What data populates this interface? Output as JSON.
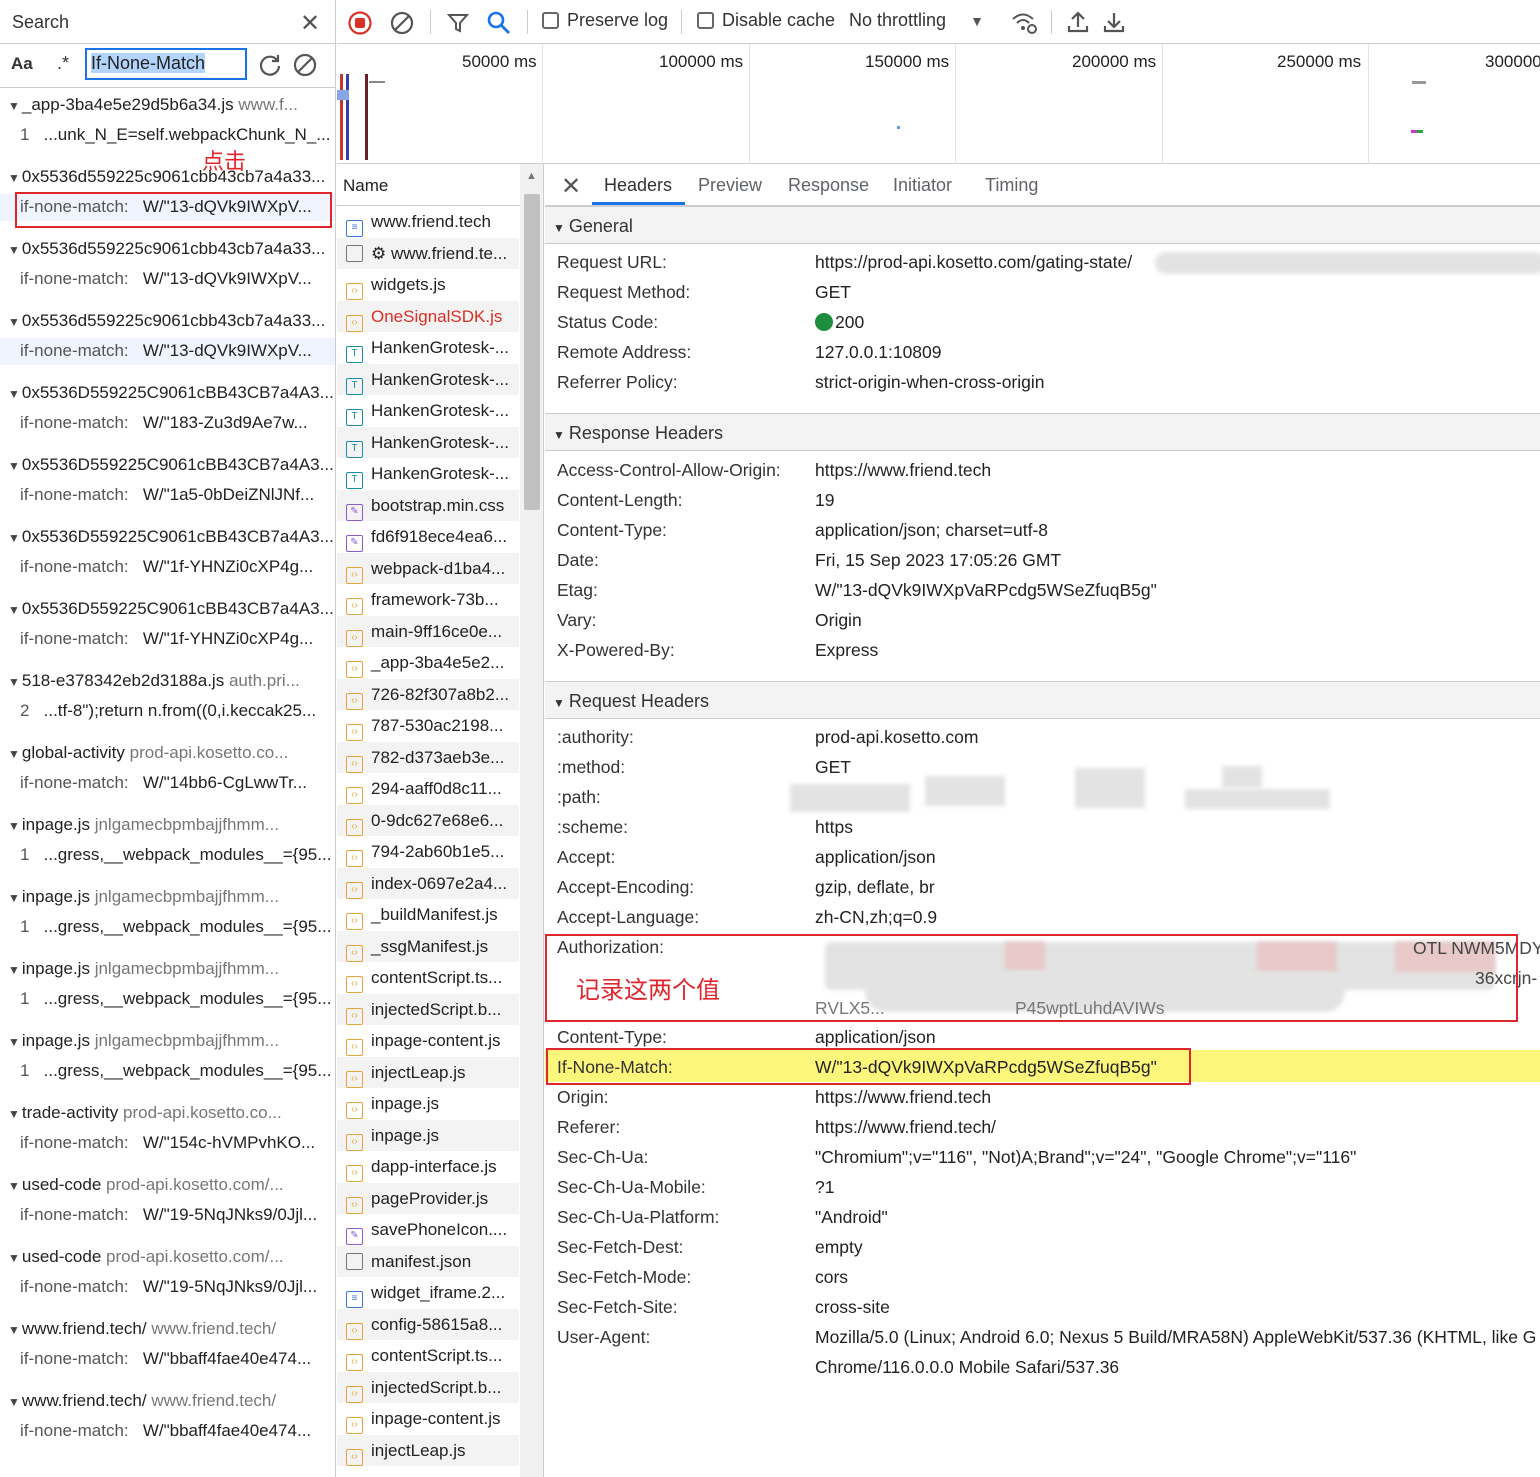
{
  "search": {
    "title": "Search",
    "case_label": "Aa",
    "regex_label": ".*",
    "query": "If-None-Match",
    "annotation": "点击",
    "results": [
      {
        "file": "_app-3ba4e5e29d5b6a34.js",
        "path": "www.f...",
        "line_num": "1",
        "line": "...unk_N_E=self.webpackChunk_N_..."
      },
      {
        "file": "0x5536d559225c9061cbb43cb7a4a33...",
        "path": "",
        "line_num": "if-none-match:",
        "line": "W/\"13-dQVk9IWXpV..."
      },
      {
        "file": "0x5536d559225c9061cbb43cb7a4a33...",
        "path": "",
        "line_num": "if-none-match:",
        "line": "W/\"13-dQVk9IWXpV..."
      },
      {
        "file": "0x5536d559225c9061cbb43cb7a4a33...",
        "path": "",
        "line_num": "if-none-match:",
        "line": "W/\"13-dQVk9IWXpV..."
      },
      {
        "file": "0x5536D559225C9061cBB43CB7a4A3...",
        "path": "",
        "line_num": "if-none-match:",
        "line": "W/\"183-Zu3d9Ae7w..."
      },
      {
        "file": "0x5536D559225C9061cBB43CB7a4A3...",
        "path": "",
        "line_num": "if-none-match:",
        "line": "W/\"1a5-0bDeiZNlJNf..."
      },
      {
        "file": "0x5536D559225C9061cBB43CB7a4A3...",
        "path": "",
        "line_num": "if-none-match:",
        "line": "W/\"1f-YHNZi0cXP4g..."
      },
      {
        "file": "0x5536D559225C9061cBB43CB7a4A3...",
        "path": "",
        "line_num": "if-none-match:",
        "line": "W/\"1f-YHNZi0cXP4g..."
      },
      {
        "file": "518-e378342eb2d3188a.js",
        "path": "auth.pri...",
        "line_num": "2",
        "line": "...tf-8\");return n.from((0,i.keccak25..."
      },
      {
        "file": "global-activity",
        "path": "prod-api.kosetto.co...",
        "line_num": "if-none-match:",
        "line": "W/\"14bb6-CgLwwTr..."
      },
      {
        "file": "inpage.js",
        "path": "jnlgamecbpmbajjfhmm...",
        "line_num": "1",
        "line": "...gress,__webpack_modules__={95..."
      },
      {
        "file": "inpage.js",
        "path": "jnlgamecbpmbajjfhmm...",
        "line_num": "1",
        "line": "...gress,__webpack_modules__={95..."
      },
      {
        "file": "inpage.js",
        "path": "jnlgamecbpmbajjfhmm...",
        "line_num": "1",
        "line": "...gress,__webpack_modules__={95..."
      },
      {
        "file": "inpage.js",
        "path": "jnlgamecbpmbajjfhmm...",
        "line_num": "1",
        "line": "...gress,__webpack_modules__={95..."
      },
      {
        "file": "trade-activity",
        "path": "prod-api.kosetto.co...",
        "line_num": "if-none-match:",
        "line": "W/\"154c-hVMPvhKO..."
      },
      {
        "file": "used-code",
        "path": "prod-api.kosetto.com/...",
        "line_num": "if-none-match:",
        "line": "W/\"19-5NqJNks9/0Jjl..."
      },
      {
        "file": "used-code",
        "path": "prod-api.kosetto.com/...",
        "line_num": "if-none-match:",
        "line": "W/\"19-5NqJNks9/0Jjl..."
      },
      {
        "file": "www.friend.tech/",
        "path": "www.friend.tech/",
        "line_num": "if-none-match:",
        "line": "W/\"bbaff4fae40e474..."
      },
      {
        "file": "www.friend.tech/",
        "path": "www.friend.tech/",
        "line_num": "if-none-match:",
        "line": "W/\"bbaff4fae40e474..."
      }
    ]
  },
  "toolbar": {
    "preserve_log": "Preserve log",
    "disable_cache": "Disable cache",
    "throttling": "No throttling"
  },
  "timeline": {
    "ticks": [
      "50000 ms",
      "100000 ms",
      "150000 ms",
      "200000 ms",
      "250000 ms",
      "300000"
    ]
  },
  "requests": {
    "header": "Name",
    "items": [
      {
        "name": "www.friend.tech",
        "type": "doc"
      },
      {
        "name": "⚙ www.friend.te...",
        "type": "other"
      },
      {
        "name": "widgets.js",
        "type": "script"
      },
      {
        "name": "OneSignalSDK.js",
        "type": "script",
        "error": true
      },
      {
        "name": "HankenGrotesk-...",
        "type": "font"
      },
      {
        "name": "HankenGrotesk-...",
        "type": "font"
      },
      {
        "name": "HankenGrotesk-...",
        "type": "font"
      },
      {
        "name": "HankenGrotesk-...",
        "type": "font"
      },
      {
        "name": "HankenGrotesk-...",
        "type": "font"
      },
      {
        "name": "bootstrap.min.css",
        "type": "style"
      },
      {
        "name": "fd6f918ece4ea6...",
        "type": "style"
      },
      {
        "name": "webpack-d1ba4...",
        "type": "script"
      },
      {
        "name": "framework-73b...",
        "type": "script"
      },
      {
        "name": "main-9ff16ce0e...",
        "type": "script"
      },
      {
        "name": "_app-3ba4e5e2...",
        "type": "script"
      },
      {
        "name": "726-82f307a8b2...",
        "type": "script"
      },
      {
        "name": "787-530ac2198...",
        "type": "script"
      },
      {
        "name": "782-d373aeb3e...",
        "type": "script"
      },
      {
        "name": "294-aaff0d8c11...",
        "type": "script"
      },
      {
        "name": "0-9dc627e68e6...",
        "type": "script"
      },
      {
        "name": "794-2ab60b1e5...",
        "type": "script"
      },
      {
        "name": "index-0697e2a4...",
        "type": "script"
      },
      {
        "name": "_buildManifest.js",
        "type": "script"
      },
      {
        "name": "_ssgManifest.js",
        "type": "script"
      },
      {
        "name": "contentScript.ts...",
        "type": "script"
      },
      {
        "name": "injectedScript.b...",
        "type": "script"
      },
      {
        "name": "inpage-content.js",
        "type": "script"
      },
      {
        "name": "injectLeap.js",
        "type": "script"
      },
      {
        "name": "inpage.js",
        "type": "script"
      },
      {
        "name": "inpage.js",
        "type": "script"
      },
      {
        "name": "dapp-interface.js",
        "type": "script"
      },
      {
        "name": "pageProvider.js",
        "type": "script"
      },
      {
        "name": "savePhoneIcon....",
        "type": "style"
      },
      {
        "name": "manifest.json",
        "type": "other"
      },
      {
        "name": "widget_iframe.2...",
        "type": "doc"
      },
      {
        "name": "config-58615a8...",
        "type": "script"
      },
      {
        "name": "contentScript.ts...",
        "type": "script"
      },
      {
        "name": "injectedScript.b...",
        "type": "script"
      },
      {
        "name": "inpage-content.js",
        "type": "script"
      },
      {
        "name": "injectLeap.js",
        "type": "script"
      },
      {
        "name": "",
        "type": "script"
      }
    ]
  },
  "details": {
    "tabs": [
      "Headers",
      "Preview",
      "Response",
      "Initiator",
      "Timing"
    ],
    "general_title": "General",
    "general": [
      {
        "k": "Request URL:",
        "v": "https://prod-api.kosetto.com/gating-state/"
      },
      {
        "k": "Request Method:",
        "v": "GET"
      },
      {
        "k": "Status Code:",
        "v": "200"
      },
      {
        "k": "Remote Address:",
        "v": "127.0.0.1:10809"
      },
      {
        "k": "Referrer Policy:",
        "v": "strict-origin-when-cross-origin"
      }
    ],
    "response_title": "Response Headers",
    "response": [
      {
        "k": "Access-Control-Allow-Origin:",
        "v": "https://www.friend.tech"
      },
      {
        "k": "Content-Length:",
        "v": "19"
      },
      {
        "k": "Content-Type:",
        "v": "application/json; charset=utf-8"
      },
      {
        "k": "Date:",
        "v": "Fri, 15 Sep 2023 17:05:26 GMT"
      },
      {
        "k": "Etag:",
        "v": "W/\"13-dQVk9IWXpVaRPcdg5WSeZfuqB5g\""
      },
      {
        "k": "Vary:",
        "v": "Origin"
      },
      {
        "k": "X-Powered-By:",
        "v": "Express"
      }
    ],
    "request_title": "Request Headers",
    "request": [
      {
        "k": ":authority:",
        "v": "prod-api.kosetto.com"
      },
      {
        "k": ":method:",
        "v": "GET"
      },
      {
        "k": ":path:",
        "v": ""
      },
      {
        "k": ":scheme:",
        "v": "https"
      },
      {
        "k": "Accept:",
        "v": "application/json"
      },
      {
        "k": "Accept-Encoding:",
        "v": "gzip, deflate, br"
      },
      {
        "k": "Accept-Language:",
        "v": "zh-CN,zh;q=0.9"
      },
      {
        "k": "Authorization:",
        "v": ""
      },
      {
        "k": "Content-Type:",
        "v": "application/json"
      },
      {
        "k": "If-None-Match:",
        "v": "W/\"13-dQVk9IWXpVaRPcdg5WSeZfuqB5g\""
      },
      {
        "k": "Origin:",
        "v": "https://www.friend.tech"
      },
      {
        "k": "Referer:",
        "v": "https://www.friend.tech/"
      },
      {
        "k": "Sec-Ch-Ua:",
        "v": "\"Chromium\";v=\"116\", \"Not)A;Brand\";v=\"24\", \"Google Chrome\";v=\"116\""
      },
      {
        "k": "Sec-Ch-Ua-Mobile:",
        "v": "?1"
      },
      {
        "k": "Sec-Ch-Ua-Platform:",
        "v": "\"Android\""
      },
      {
        "k": "Sec-Fetch-Dest:",
        "v": "empty"
      },
      {
        "k": "Sec-Fetch-Mode:",
        "v": "cors"
      },
      {
        "k": "Sec-Fetch-Site:",
        "v": "cross-site"
      },
      {
        "k": "User-Agent:",
        "v": "Mozilla/5.0 (Linux; Android 6.0; Nexus 5 Build/MRA58N) AppleWebKit/537.36 (KHTML, like G"
      }
    ],
    "auth_partial_1": "OTL NWM5MDY",
    "auth_partial_2": "36xcrjn-",
    "auth_partial_3": "RVLX5...",
    "auth_partial_4": "P45wptLuhdAVIWs",
    "user_agent_cont": "Chrome/116.0.0.0 Mobile Safari/537.36",
    "annotation": "记录这两个值",
    "colors": {
      "highlight": "#fcf67a",
      "annotation": "#e0262d",
      "status_ok": "#1e8e3e",
      "accent": "#1a73e8"
    }
  }
}
